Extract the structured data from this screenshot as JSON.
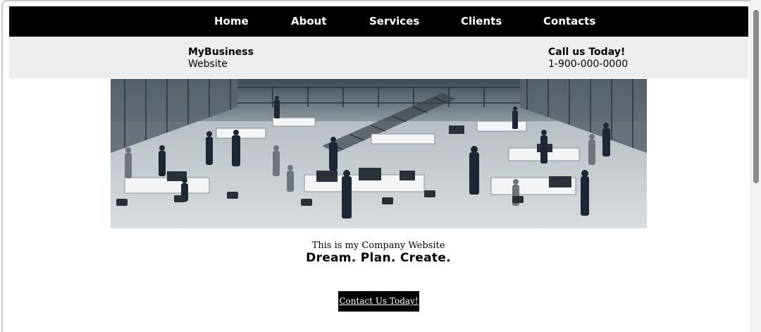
{
  "nav": {
    "items": [
      {
        "label": "Home"
      },
      {
        "label": "About"
      },
      {
        "label": "Services"
      },
      {
        "label": "Clients"
      },
      {
        "label": "Contacts"
      }
    ]
  },
  "brand": {
    "name": "MyBusiness",
    "subtitle": "Website"
  },
  "contact": {
    "heading": "Call us Today!",
    "phone": "1-900-000-0000"
  },
  "hero": {
    "image_alt": "Open-plan office with people working at desks"
  },
  "main": {
    "tagline": "This is my Company Website",
    "slogan": "Dream. Plan. Create.",
    "cta_label": "Contact Us Today!"
  },
  "colors": {
    "nav_bg": "#000000",
    "info_bg": "#eeeeee",
    "cta_bg": "#000000"
  }
}
